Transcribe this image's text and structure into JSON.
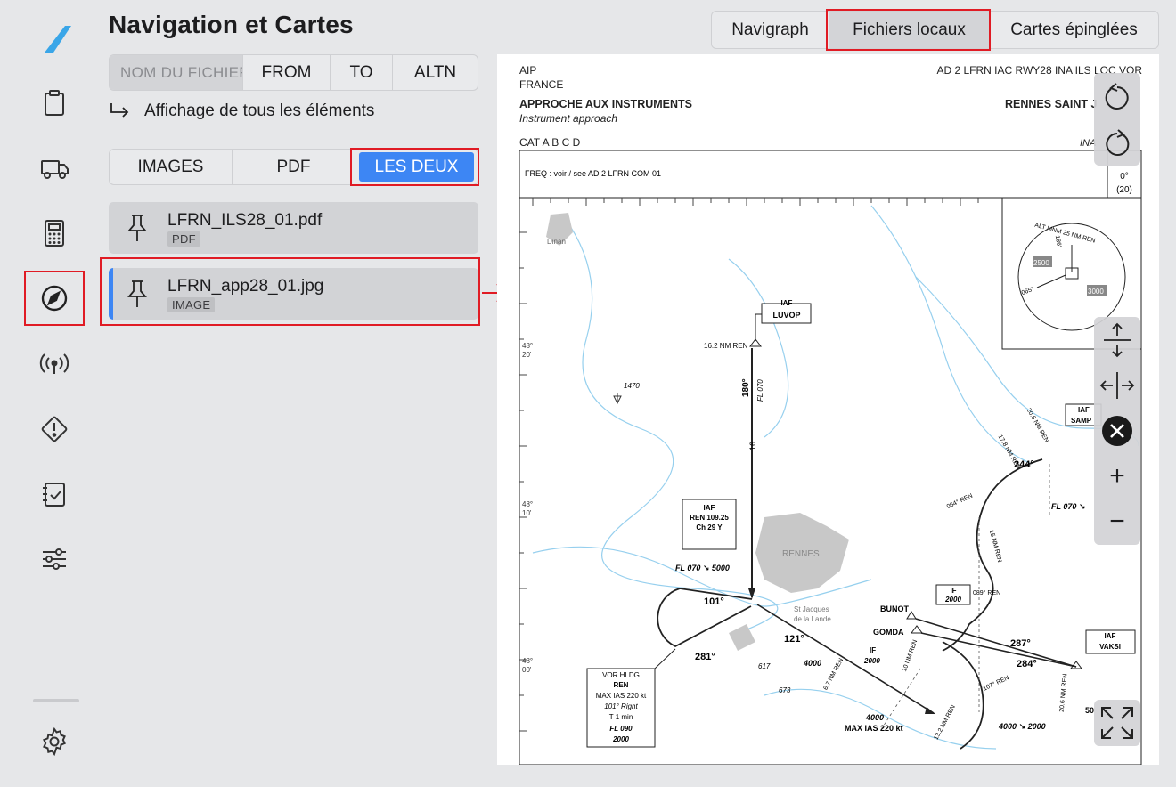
{
  "page": {
    "title": "Navigation et Cartes"
  },
  "sidebar": {
    "items": [
      {
        "name": "clipboard",
        "icon": "clipboard-icon"
      },
      {
        "name": "truck",
        "icon": "truck-icon"
      },
      {
        "name": "calculator",
        "icon": "calculator-icon"
      },
      {
        "name": "navigation",
        "icon": "compass-icon",
        "active": true
      },
      {
        "name": "radio",
        "icon": "antenna-icon"
      },
      {
        "name": "warning",
        "icon": "warning-icon"
      },
      {
        "name": "checklist",
        "icon": "checklist-icon"
      },
      {
        "name": "settings-sliders",
        "icon": "sliders-icon"
      }
    ],
    "settings_icon": "gear-icon"
  },
  "search": {
    "name_placeholder": "NOM DU FICHIER",
    "filters": [
      "FROM",
      "TO",
      "ALTN"
    ]
  },
  "show_all_label": "Affichage de tous les éléments",
  "type_filter": {
    "options": [
      "IMAGES",
      "PDF",
      "LES DEUX"
    ],
    "selected": "LES DEUX"
  },
  "files": [
    {
      "name": "LFRN_ILS28_01.pdf",
      "type": "PDF",
      "selected": false
    },
    {
      "name": "LFRN_app28_01.jpg",
      "type": "IMAGE",
      "selected": true
    }
  ],
  "source_tabs": {
    "items": [
      "Navigraph",
      "Fichiers locaux",
      "Cartes épinglées"
    ],
    "selected": "Fichiers locaux"
  },
  "chart": {
    "aip": "AIP",
    "country": "FRANCE",
    "ref": "AD 2 LFRN IAC RWY28 INA ILS LOC VOR",
    "heading": "APPROCHE AUX INSTRUMENTS",
    "heading_en": "Instrument approach",
    "place": "RENNES SAINT J",
    "cat": "CAT A B C D",
    "ina": "INA",
    "freq": "FREQ : voir / see AD 2 LFRN COM 01",
    "var": "0°",
    "var2": "(20)",
    "msa": "ALT MNM 25 NM REN",
    "msa_2500": "2500",
    "msa_3000": "3000",
    "msa_186": "186°",
    "msa_065": "065°",
    "dinan": "Dinan",
    "lat1": "48°",
    "lat1b": "20'",
    "lat2": "48°",
    "lat2b": "10'",
    "lat3": "48°",
    "lat3b": "00'",
    "iaf": "IAF",
    "luvop": "LUVOP",
    "luvop_dist": "16.2 NM REN",
    "fl070": "FL 070",
    "crs180": "180°",
    "leg16": "16",
    "elev1470": "1470",
    "ren_vor": "REN 109.25",
    "ren_ch": "Ch 29 Y",
    "fl070_5000": "FL 070 ↘ 5000",
    "crs101": "101°",
    "crs281": "281°",
    "crs121": "121°",
    "rennes": "RENNES",
    "st_jacques": "St Jacques",
    "la_lande": "de la Lande",
    "hldg1": "VOR HLDG",
    "hldg2": "REN",
    "hldg3": "MAX IAS 220 kt",
    "hldg4": "101° Right",
    "hldg5": "T 1 min",
    "hldg6": "FL 090",
    "hldg7": "2000",
    "e617": "617",
    "e673": "673",
    "alt4000a": "4000",
    "d67": "6.7 NM REN",
    "alt4000b": "4000",
    "maxias": "MAX IAS 220 kt",
    "d132": "13.2 NM REN",
    "samp": "SAMP",
    "d206": "20.6 NM REN",
    "d178": "17.8 NM REN",
    "crs244": "244°",
    "crs064": "064° REN",
    "fl070b": "FL 070 ↘",
    "d15": "15 NM REN",
    "if": "IF",
    "if2000": "2000",
    "crs089": "089° REN",
    "bunot": "BUNOT",
    "gomda": "GOMDA",
    "if_b": "IF",
    "if2000b": "2000",
    "d10": "10 NM REN",
    "crs287": "287°",
    "crs284": "284°",
    "vaksi": "VAKSI",
    "crs107": "107° REN",
    "alt4000_2000": "4000 ↘ 2000",
    "d206b": "20.6 NM REN",
    "alt50": "50"
  },
  "viewer_tools": {
    "rotate_ccw": "rotate-ccw-icon",
    "rotate_cw": "rotate-cw-icon",
    "fit_height": "fit-height-icon",
    "fit_width": "fit-width-icon",
    "close": "close-icon",
    "zoom_in": "+",
    "zoom_out": "−",
    "fullscreen": "fullscreen-icon"
  },
  "colors": {
    "accent": "#3d86f4",
    "highlight": "#e01b24",
    "background": "#e6e7e9"
  }
}
